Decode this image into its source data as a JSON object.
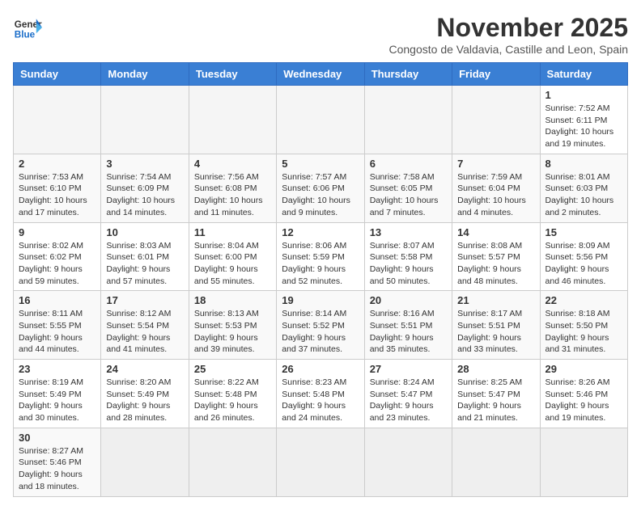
{
  "logo": {
    "general": "General",
    "blue": "Blue"
  },
  "header": {
    "month_title": "November 2025",
    "subtitle": "Congosto de Valdavia, Castille and Leon, Spain"
  },
  "weekdays": [
    "Sunday",
    "Monday",
    "Tuesday",
    "Wednesday",
    "Thursday",
    "Friday",
    "Saturday"
  ],
  "weeks": [
    [
      {
        "day": "",
        "info": ""
      },
      {
        "day": "",
        "info": ""
      },
      {
        "day": "",
        "info": ""
      },
      {
        "day": "",
        "info": ""
      },
      {
        "day": "",
        "info": ""
      },
      {
        "day": "",
        "info": ""
      },
      {
        "day": "1",
        "info": "Sunrise: 7:52 AM\nSunset: 6:11 PM\nDaylight: 10 hours and 19 minutes."
      }
    ],
    [
      {
        "day": "2",
        "info": "Sunrise: 7:53 AM\nSunset: 6:10 PM\nDaylight: 10 hours and 17 minutes."
      },
      {
        "day": "3",
        "info": "Sunrise: 7:54 AM\nSunset: 6:09 PM\nDaylight: 10 hours and 14 minutes."
      },
      {
        "day": "4",
        "info": "Sunrise: 7:56 AM\nSunset: 6:08 PM\nDaylight: 10 hours and 11 minutes."
      },
      {
        "day": "5",
        "info": "Sunrise: 7:57 AM\nSunset: 6:06 PM\nDaylight: 10 hours and 9 minutes."
      },
      {
        "day": "6",
        "info": "Sunrise: 7:58 AM\nSunset: 6:05 PM\nDaylight: 10 hours and 7 minutes."
      },
      {
        "day": "7",
        "info": "Sunrise: 7:59 AM\nSunset: 6:04 PM\nDaylight: 10 hours and 4 minutes."
      },
      {
        "day": "8",
        "info": "Sunrise: 8:01 AM\nSunset: 6:03 PM\nDaylight: 10 hours and 2 minutes."
      }
    ],
    [
      {
        "day": "9",
        "info": "Sunrise: 8:02 AM\nSunset: 6:02 PM\nDaylight: 9 hours and 59 minutes."
      },
      {
        "day": "10",
        "info": "Sunrise: 8:03 AM\nSunset: 6:01 PM\nDaylight: 9 hours and 57 minutes."
      },
      {
        "day": "11",
        "info": "Sunrise: 8:04 AM\nSunset: 6:00 PM\nDaylight: 9 hours and 55 minutes."
      },
      {
        "day": "12",
        "info": "Sunrise: 8:06 AM\nSunset: 5:59 PM\nDaylight: 9 hours and 52 minutes."
      },
      {
        "day": "13",
        "info": "Sunrise: 8:07 AM\nSunset: 5:58 PM\nDaylight: 9 hours and 50 minutes."
      },
      {
        "day": "14",
        "info": "Sunrise: 8:08 AM\nSunset: 5:57 PM\nDaylight: 9 hours and 48 minutes."
      },
      {
        "day": "15",
        "info": "Sunrise: 8:09 AM\nSunset: 5:56 PM\nDaylight: 9 hours and 46 minutes."
      }
    ],
    [
      {
        "day": "16",
        "info": "Sunrise: 8:11 AM\nSunset: 5:55 PM\nDaylight: 9 hours and 44 minutes."
      },
      {
        "day": "17",
        "info": "Sunrise: 8:12 AM\nSunset: 5:54 PM\nDaylight: 9 hours and 41 minutes."
      },
      {
        "day": "18",
        "info": "Sunrise: 8:13 AM\nSunset: 5:53 PM\nDaylight: 9 hours and 39 minutes."
      },
      {
        "day": "19",
        "info": "Sunrise: 8:14 AM\nSunset: 5:52 PM\nDaylight: 9 hours and 37 minutes."
      },
      {
        "day": "20",
        "info": "Sunrise: 8:16 AM\nSunset: 5:51 PM\nDaylight: 9 hours and 35 minutes."
      },
      {
        "day": "21",
        "info": "Sunrise: 8:17 AM\nSunset: 5:51 PM\nDaylight: 9 hours and 33 minutes."
      },
      {
        "day": "22",
        "info": "Sunrise: 8:18 AM\nSunset: 5:50 PM\nDaylight: 9 hours and 31 minutes."
      }
    ],
    [
      {
        "day": "23",
        "info": "Sunrise: 8:19 AM\nSunset: 5:49 PM\nDaylight: 9 hours and 30 minutes."
      },
      {
        "day": "24",
        "info": "Sunrise: 8:20 AM\nSunset: 5:49 PM\nDaylight: 9 hours and 28 minutes."
      },
      {
        "day": "25",
        "info": "Sunrise: 8:22 AM\nSunset: 5:48 PM\nDaylight: 9 hours and 26 minutes."
      },
      {
        "day": "26",
        "info": "Sunrise: 8:23 AM\nSunset: 5:48 PM\nDaylight: 9 hours and 24 minutes."
      },
      {
        "day": "27",
        "info": "Sunrise: 8:24 AM\nSunset: 5:47 PM\nDaylight: 9 hours and 23 minutes."
      },
      {
        "day": "28",
        "info": "Sunrise: 8:25 AM\nSunset: 5:47 PM\nDaylight: 9 hours and 21 minutes."
      },
      {
        "day": "29",
        "info": "Sunrise: 8:26 AM\nSunset: 5:46 PM\nDaylight: 9 hours and 19 minutes."
      }
    ],
    [
      {
        "day": "30",
        "info": "Sunrise: 8:27 AM\nSunset: 5:46 PM\nDaylight: 9 hours and 18 minutes."
      },
      {
        "day": "",
        "info": ""
      },
      {
        "day": "",
        "info": ""
      },
      {
        "day": "",
        "info": ""
      },
      {
        "day": "",
        "info": ""
      },
      {
        "day": "",
        "info": ""
      },
      {
        "day": "",
        "info": ""
      }
    ]
  ]
}
